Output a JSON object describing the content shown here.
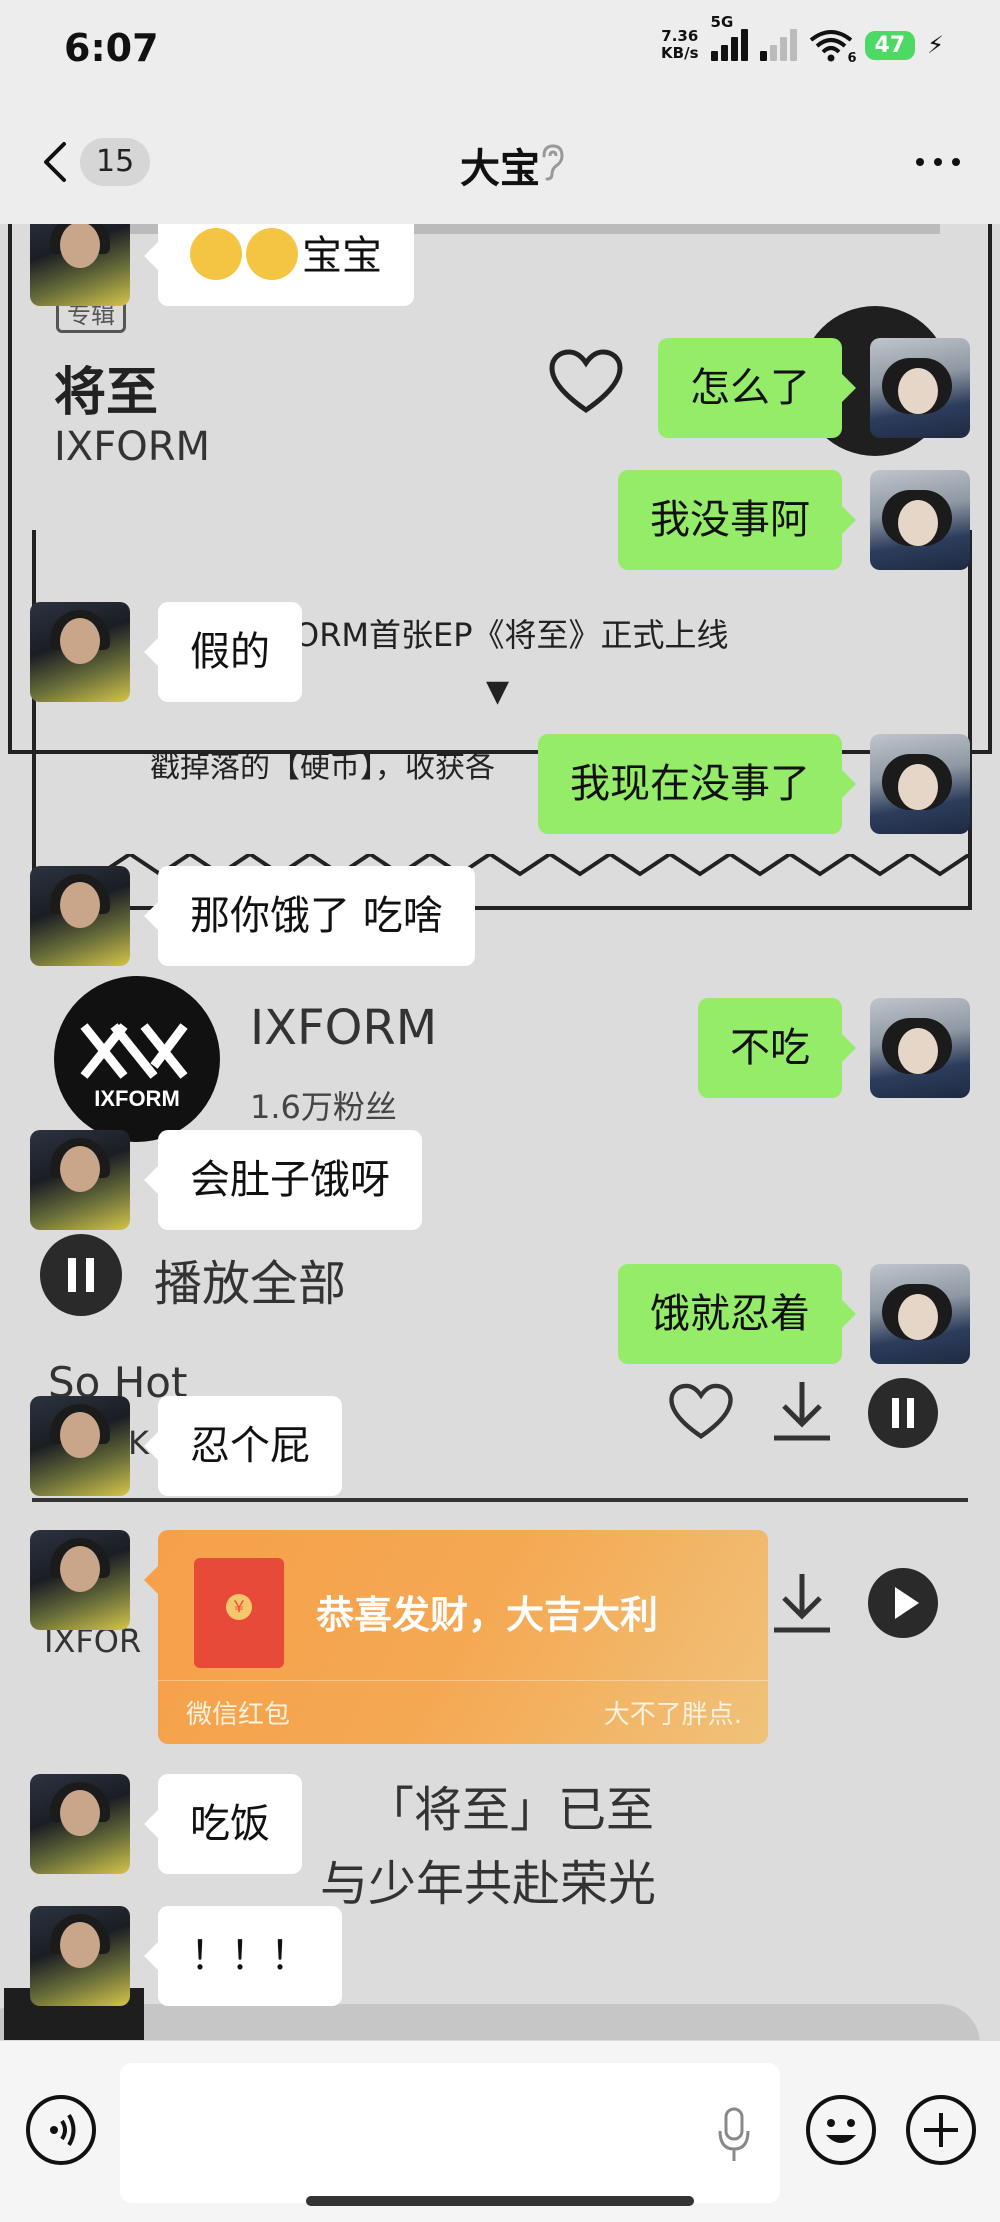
{
  "status": {
    "time": "6:07",
    "net_speed_value": "7.36",
    "net_speed_unit": "KB/s",
    "network_type": "5G",
    "wifi_badge": "6",
    "battery": "47"
  },
  "header": {
    "unread_count": "15",
    "title": "大宝"
  },
  "wallpaper": {
    "album_tag": "专辑",
    "album_title": "将至",
    "album_artist": "IXFORM",
    "announcement": "ORM首张EP《将至》正式上线",
    "arrow": "▼",
    "coin_text": "戳掉落的【硬币】，收获各",
    "artist_name": "IXFORM",
    "followers": "1.6万粉丝",
    "play_all": "播放全部",
    "song1": "So Hot",
    "song1_artist": "K",
    "song2_artist": "IXFOR",
    "slogan1": "「将至」已至",
    "slogan2": "与少年共赴荣光",
    "logo_text": "IXFORM"
  },
  "messages": [
    {
      "side": "left",
      "text": "宝宝"
    },
    {
      "side": "right",
      "text": "怎么了"
    },
    {
      "side": "right",
      "text": "我没事阿"
    },
    {
      "side": "left",
      "text": "假的"
    },
    {
      "side": "right",
      "text": "我现在没事了"
    },
    {
      "side": "left",
      "text": "那你饿了  吃啥"
    },
    {
      "side": "right",
      "text": "不吃"
    },
    {
      "side": "left",
      "text": "会肚子饿呀"
    },
    {
      "side": "right",
      "text": "饿就忍着"
    },
    {
      "side": "left",
      "text": "忍个屁"
    },
    {
      "side": "left",
      "text": "吃饭"
    },
    {
      "side": "left",
      "text": "！！！"
    }
  ],
  "red_packet": {
    "greeting": "恭喜发财，大吉大利",
    "label": "微信红包",
    "sender": "大不了胖点.",
    "coin": "￥"
  },
  "input": {
    "value": ""
  }
}
